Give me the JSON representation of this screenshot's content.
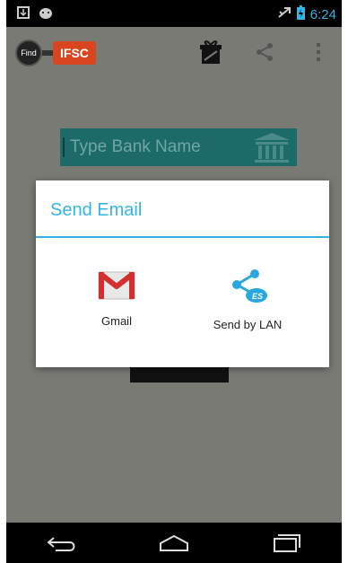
{
  "status_bar": {
    "time": "6:24",
    "icons": [
      "download-icon",
      "android-icon",
      "airplane-icon",
      "battery-icon"
    ]
  },
  "action_bar": {
    "logo_find": "Find",
    "logo_ifsc": "IFSC",
    "actions": [
      "gift-icon",
      "share-icon",
      "overflow-menu-icon"
    ]
  },
  "content": {
    "bank_placeholder": "Type Bank Name"
  },
  "dialog": {
    "title": "Send Email",
    "options": [
      {
        "label": "Gmail",
        "icon": "gmail-icon"
      },
      {
        "label": "Send by LAN",
        "icon": "es-share-icon"
      }
    ]
  },
  "nav_bar": {
    "buttons": [
      "back-icon",
      "home-icon",
      "recent-apps-icon"
    ]
  },
  "colors": {
    "accent": "#33b5e5",
    "ifsc": "#d9451f",
    "input_bg": "#1d6b69",
    "dim_bg": "#7a7a75"
  }
}
